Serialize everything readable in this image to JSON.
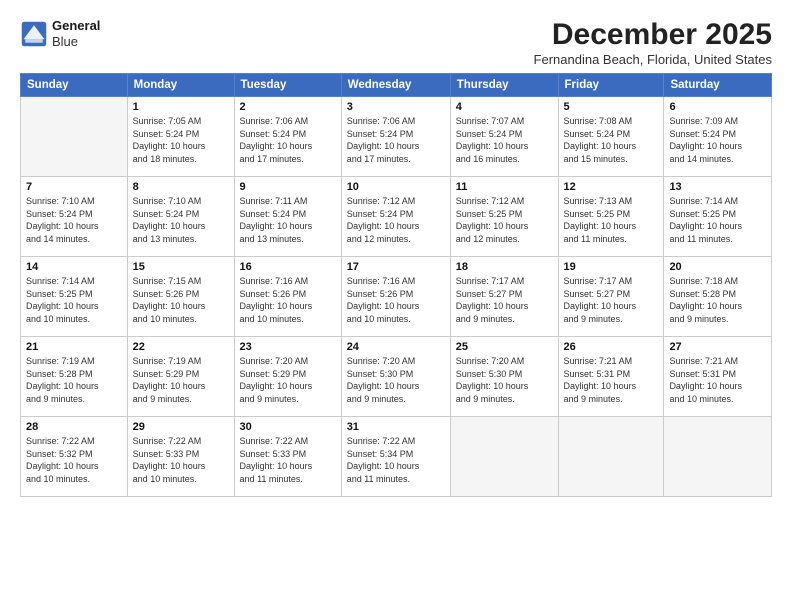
{
  "logo": {
    "line1": "General",
    "line2": "Blue"
  },
  "title": "December 2025",
  "subtitle": "Fernandina Beach, Florida, United States",
  "days_of_week": [
    "Sunday",
    "Monday",
    "Tuesday",
    "Wednesday",
    "Thursday",
    "Friday",
    "Saturday"
  ],
  "weeks": [
    [
      {
        "day": "",
        "info": ""
      },
      {
        "day": "1",
        "info": "Sunrise: 7:05 AM\nSunset: 5:24 PM\nDaylight: 10 hours\nand 18 minutes."
      },
      {
        "day": "2",
        "info": "Sunrise: 7:06 AM\nSunset: 5:24 PM\nDaylight: 10 hours\nand 17 minutes."
      },
      {
        "day": "3",
        "info": "Sunrise: 7:06 AM\nSunset: 5:24 PM\nDaylight: 10 hours\nand 17 minutes."
      },
      {
        "day": "4",
        "info": "Sunrise: 7:07 AM\nSunset: 5:24 PM\nDaylight: 10 hours\nand 16 minutes."
      },
      {
        "day": "5",
        "info": "Sunrise: 7:08 AM\nSunset: 5:24 PM\nDaylight: 10 hours\nand 15 minutes."
      },
      {
        "day": "6",
        "info": "Sunrise: 7:09 AM\nSunset: 5:24 PM\nDaylight: 10 hours\nand 14 minutes."
      }
    ],
    [
      {
        "day": "7",
        "info": "Sunrise: 7:10 AM\nSunset: 5:24 PM\nDaylight: 10 hours\nand 14 minutes."
      },
      {
        "day": "8",
        "info": "Sunrise: 7:10 AM\nSunset: 5:24 PM\nDaylight: 10 hours\nand 13 minutes."
      },
      {
        "day": "9",
        "info": "Sunrise: 7:11 AM\nSunset: 5:24 PM\nDaylight: 10 hours\nand 13 minutes."
      },
      {
        "day": "10",
        "info": "Sunrise: 7:12 AM\nSunset: 5:24 PM\nDaylight: 10 hours\nand 12 minutes."
      },
      {
        "day": "11",
        "info": "Sunrise: 7:12 AM\nSunset: 5:25 PM\nDaylight: 10 hours\nand 12 minutes."
      },
      {
        "day": "12",
        "info": "Sunrise: 7:13 AM\nSunset: 5:25 PM\nDaylight: 10 hours\nand 11 minutes."
      },
      {
        "day": "13",
        "info": "Sunrise: 7:14 AM\nSunset: 5:25 PM\nDaylight: 10 hours\nand 11 minutes."
      }
    ],
    [
      {
        "day": "14",
        "info": "Sunrise: 7:14 AM\nSunset: 5:25 PM\nDaylight: 10 hours\nand 10 minutes."
      },
      {
        "day": "15",
        "info": "Sunrise: 7:15 AM\nSunset: 5:26 PM\nDaylight: 10 hours\nand 10 minutes."
      },
      {
        "day": "16",
        "info": "Sunrise: 7:16 AM\nSunset: 5:26 PM\nDaylight: 10 hours\nand 10 minutes."
      },
      {
        "day": "17",
        "info": "Sunrise: 7:16 AM\nSunset: 5:26 PM\nDaylight: 10 hours\nand 10 minutes."
      },
      {
        "day": "18",
        "info": "Sunrise: 7:17 AM\nSunset: 5:27 PM\nDaylight: 10 hours\nand 9 minutes."
      },
      {
        "day": "19",
        "info": "Sunrise: 7:17 AM\nSunset: 5:27 PM\nDaylight: 10 hours\nand 9 minutes."
      },
      {
        "day": "20",
        "info": "Sunrise: 7:18 AM\nSunset: 5:28 PM\nDaylight: 10 hours\nand 9 minutes."
      }
    ],
    [
      {
        "day": "21",
        "info": "Sunrise: 7:19 AM\nSunset: 5:28 PM\nDaylight: 10 hours\nand 9 minutes."
      },
      {
        "day": "22",
        "info": "Sunrise: 7:19 AM\nSunset: 5:29 PM\nDaylight: 10 hours\nand 9 minutes."
      },
      {
        "day": "23",
        "info": "Sunrise: 7:20 AM\nSunset: 5:29 PM\nDaylight: 10 hours\nand 9 minutes."
      },
      {
        "day": "24",
        "info": "Sunrise: 7:20 AM\nSunset: 5:30 PM\nDaylight: 10 hours\nand 9 minutes."
      },
      {
        "day": "25",
        "info": "Sunrise: 7:20 AM\nSunset: 5:30 PM\nDaylight: 10 hours\nand 9 minutes."
      },
      {
        "day": "26",
        "info": "Sunrise: 7:21 AM\nSunset: 5:31 PM\nDaylight: 10 hours\nand 9 minutes."
      },
      {
        "day": "27",
        "info": "Sunrise: 7:21 AM\nSunset: 5:31 PM\nDaylight: 10 hours\nand 10 minutes."
      }
    ],
    [
      {
        "day": "28",
        "info": "Sunrise: 7:22 AM\nSunset: 5:32 PM\nDaylight: 10 hours\nand 10 minutes."
      },
      {
        "day": "29",
        "info": "Sunrise: 7:22 AM\nSunset: 5:33 PM\nDaylight: 10 hours\nand 10 minutes."
      },
      {
        "day": "30",
        "info": "Sunrise: 7:22 AM\nSunset: 5:33 PM\nDaylight: 10 hours\nand 11 minutes."
      },
      {
        "day": "31",
        "info": "Sunrise: 7:22 AM\nSunset: 5:34 PM\nDaylight: 10 hours\nand 11 minutes."
      },
      {
        "day": "",
        "info": ""
      },
      {
        "day": "",
        "info": ""
      },
      {
        "day": "",
        "info": ""
      }
    ]
  ]
}
